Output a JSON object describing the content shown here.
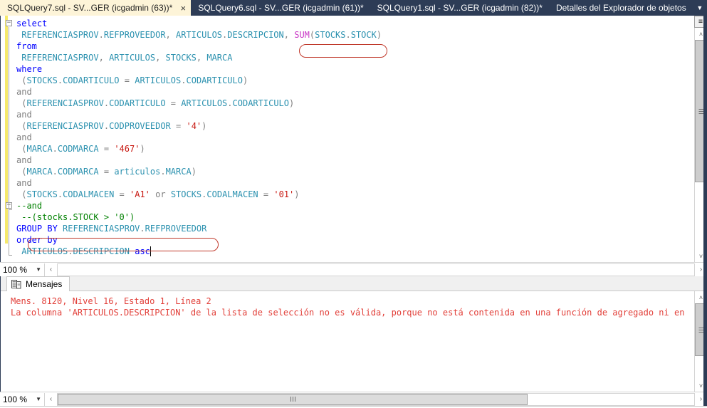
{
  "window": {
    "app": "SQL Server Management Studio",
    "tabs": [
      {
        "label": "SQLQuery7.sql - SV...GER (icgadmin (63))*",
        "active": true,
        "close_icon": "×"
      },
      {
        "label": "SQLQuery6.sql - SV...GER (icgadmin (61))*",
        "active": false
      },
      {
        "label": "SQLQuery1.sql - SV...GER (icgadmin (82))*",
        "active": false
      },
      {
        "label": "Detalles del Explorador de objetos",
        "active": false
      }
    ],
    "tab_overflow_icon": "▼"
  },
  "editor": {
    "zoom_level": "100 %",
    "zoom_caret_icon": "▼",
    "split_icon": "≡",
    "scroll_up_icon": "˄",
    "scroll_down_icon": "˅",
    "scroll_left_icon": "‹",
    "scroll_right_icon": "›",
    "collapse_icon": "−",
    "caret_visible": true,
    "lines": [
      {
        "indent": 0,
        "outline": "collapse",
        "tokens": [
          {
            "t": "select",
            "c": "kw"
          }
        ]
      },
      {
        "indent": 1,
        "tokens": [
          {
            "t": "REFERENCIASPROV",
            "c": "ident"
          },
          {
            "t": ".",
            "c": "op"
          },
          {
            "t": "REFPROVEEDOR",
            "c": "ident"
          },
          {
            "t": ", ",
            "c": "op"
          },
          {
            "t": "ARTICULOS",
            "c": "ident"
          },
          {
            "t": ".",
            "c": "op"
          },
          {
            "t": "DESCRIPCION",
            "c": "ident"
          },
          {
            "t": ",",
            "c": "op"
          },
          {
            "t": " ",
            "c": "plain"
          },
          {
            "t": "SUM",
            "c": "fn"
          },
          {
            "t": "(",
            "c": "op"
          },
          {
            "t": "STOCKS",
            "c": "ident"
          },
          {
            "t": ".",
            "c": "op"
          },
          {
            "t": "STOCK",
            "c": "ident"
          },
          {
            "t": ")",
            "c": "op"
          }
        ]
      },
      {
        "indent": 0,
        "tokens": [
          {
            "t": "from",
            "c": "kw"
          }
        ]
      },
      {
        "indent": 1,
        "tokens": [
          {
            "t": "REFERENCIASPROV",
            "c": "ident"
          },
          {
            "t": ", ",
            "c": "op"
          },
          {
            "t": "ARTICULOS",
            "c": "ident"
          },
          {
            "t": ", ",
            "c": "op"
          },
          {
            "t": "STOCKS",
            "c": "ident"
          },
          {
            "t": ", ",
            "c": "op"
          },
          {
            "t": "MARCA",
            "c": "ident"
          }
        ]
      },
      {
        "indent": 0,
        "tokens": [
          {
            "t": "where",
            "c": "kw"
          }
        ]
      },
      {
        "indent": 1,
        "tokens": [
          {
            "t": "(",
            "c": "op"
          },
          {
            "t": "STOCKS",
            "c": "ident"
          },
          {
            "t": ".",
            "c": "op"
          },
          {
            "t": "CODARTICULO",
            "c": "ident"
          },
          {
            "t": " = ",
            "c": "op"
          },
          {
            "t": "ARTICULOS",
            "c": "ident"
          },
          {
            "t": ".",
            "c": "op"
          },
          {
            "t": "CODARTICULO",
            "c": "ident"
          },
          {
            "t": ")",
            "c": "op"
          }
        ]
      },
      {
        "indent": 0,
        "tokens": [
          {
            "t": "and",
            "c": "op"
          }
        ]
      },
      {
        "indent": 1,
        "tokens": [
          {
            "t": "(",
            "c": "op"
          },
          {
            "t": "REFERENCIASPROV",
            "c": "ident"
          },
          {
            "t": ".",
            "c": "op"
          },
          {
            "t": "CODARTICULO",
            "c": "ident"
          },
          {
            "t": " = ",
            "c": "op"
          },
          {
            "t": "ARTICULOS",
            "c": "ident"
          },
          {
            "t": ".",
            "c": "op"
          },
          {
            "t": "CODARTICULO",
            "c": "ident"
          },
          {
            "t": ")",
            "c": "op"
          }
        ]
      },
      {
        "indent": 0,
        "tokens": [
          {
            "t": "and",
            "c": "op"
          }
        ]
      },
      {
        "indent": 1,
        "tokens": [
          {
            "t": "(",
            "c": "op"
          },
          {
            "t": "REFERENCIASPROV",
            "c": "ident"
          },
          {
            "t": ".",
            "c": "op"
          },
          {
            "t": "CODPROVEEDOR",
            "c": "ident"
          },
          {
            "t": " = ",
            "c": "op"
          },
          {
            "t": "'4'",
            "c": "str"
          },
          {
            "t": ")",
            "c": "op"
          }
        ]
      },
      {
        "indent": 0,
        "tokens": [
          {
            "t": "and",
            "c": "op"
          }
        ]
      },
      {
        "indent": 1,
        "tokens": [
          {
            "t": "(",
            "c": "op"
          },
          {
            "t": "MARCA",
            "c": "ident"
          },
          {
            "t": ".",
            "c": "op"
          },
          {
            "t": "CODMARCA",
            "c": "ident"
          },
          {
            "t": " = ",
            "c": "op"
          },
          {
            "t": "'467'",
            "c": "str"
          },
          {
            "t": ")",
            "c": "op"
          }
        ]
      },
      {
        "indent": 0,
        "tokens": [
          {
            "t": "and",
            "c": "op"
          }
        ]
      },
      {
        "indent": 1,
        "tokens": [
          {
            "t": "(",
            "c": "op"
          },
          {
            "t": "MARCA",
            "c": "ident"
          },
          {
            "t": ".",
            "c": "op"
          },
          {
            "t": "CODMARCA",
            "c": "ident"
          },
          {
            "t": " = ",
            "c": "op"
          },
          {
            "t": "articulos",
            "c": "ident"
          },
          {
            "t": ".",
            "c": "op"
          },
          {
            "t": "MARCA",
            "c": "ident"
          },
          {
            "t": ")",
            "c": "op"
          }
        ]
      },
      {
        "indent": 0,
        "tokens": [
          {
            "t": "and",
            "c": "op"
          }
        ]
      },
      {
        "indent": 1,
        "tokens": [
          {
            "t": "(",
            "c": "op"
          },
          {
            "t": "STOCKS",
            "c": "ident"
          },
          {
            "t": ".",
            "c": "op"
          },
          {
            "t": "CODALMACEN",
            "c": "ident"
          },
          {
            "t": " = ",
            "c": "op"
          },
          {
            "t": "'A1'",
            "c": "str"
          },
          {
            "t": " or ",
            "c": "op"
          },
          {
            "t": "STOCKS",
            "c": "ident"
          },
          {
            "t": ".",
            "c": "op"
          },
          {
            "t": "CODALMACEN",
            "c": "ident"
          },
          {
            "t": " = ",
            "c": "op"
          },
          {
            "t": "'01'",
            "c": "str"
          },
          {
            "t": ")",
            "c": "op"
          }
        ]
      },
      {
        "indent": 0,
        "outline": "collapse",
        "tokens": [
          {
            "t": "--and",
            "c": "cmt"
          }
        ]
      },
      {
        "indent": 1,
        "tokens": [
          {
            "t": "--(stocks.STOCK > '0')",
            "c": "cmt"
          }
        ]
      },
      {
        "indent": 0,
        "tokens": [
          {
            "t": "GROUP BY",
            "c": "kw"
          },
          {
            "t": " ",
            "c": "plain"
          },
          {
            "t": "REFERENCIASPROV",
            "c": "ident"
          },
          {
            "t": ".",
            "c": "op"
          },
          {
            "t": "REFPROVEEDOR",
            "c": "ident"
          }
        ]
      },
      {
        "indent": 0,
        "tokens": [
          {
            "t": "order by",
            "c": "kw"
          }
        ]
      },
      {
        "indent": 1,
        "tokens": [
          {
            "t": "ARTICULOS",
            "c": "ident"
          },
          {
            "t": ".",
            "c": "op"
          },
          {
            "t": "DESCRIPCION",
            "c": "ident"
          },
          {
            "t": " ",
            "c": "plain"
          },
          {
            "t": "asc",
            "c": "kw"
          }
        ]
      }
    ],
    "annotations": [
      {
        "name": "sum-highlight",
        "target": "SUM(STOCKS.STOCK)",
        "color": "#c0392b"
      },
      {
        "name": "groupby-highlight",
        "target": "GROUP BY REFERENCIASPROV.REFPROVEEDOR",
        "color": "#c0392b"
      }
    ]
  },
  "messages": {
    "tab_label": "Mensajes",
    "tab_icon": "messages-grid-icon",
    "zoom_level": "100 %",
    "zoom_caret_icon": "▼",
    "scroll_up_icon": "˄",
    "scroll_down_icon": "˅",
    "scroll_left_icon": "‹",
    "scroll_right_icon": "›",
    "lines": [
      "Mens. 8120, Nivel 16, Estado 1, Línea 2",
      "La columna 'ARTICULOS.DESCRIPCION' de la lista de selección no es válida, porque no está contenida en una función de agregado ni en la"
    ]
  },
  "colors": {
    "tabstrip_bg": "#2d3c56",
    "active_tab_bg": "#fdf4d8",
    "keyword": "#0000ff",
    "identifier": "#2b91af",
    "string": "#c81912",
    "comment": "#008000",
    "function": "#ca38c6",
    "error_text": "#e2403a",
    "change_bar": "#f5e96b",
    "annotation": "#c0392b"
  }
}
